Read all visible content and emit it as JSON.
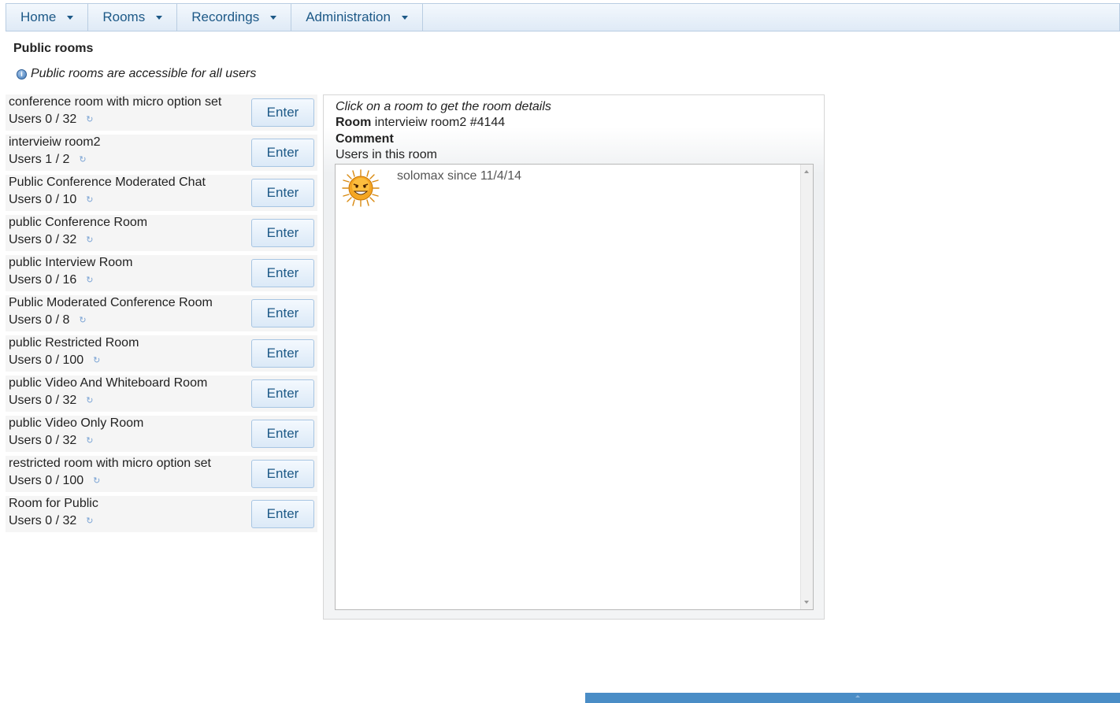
{
  "menu": {
    "items": [
      {
        "label": "Home"
      },
      {
        "label": "Rooms"
      },
      {
        "label": "Recordings"
      },
      {
        "label": "Administration"
      }
    ]
  },
  "page": {
    "title": "Public rooms",
    "info": "Public rooms are accessible for all users"
  },
  "rooms": [
    {
      "name": "conference room with micro option set",
      "users": "Users 0 / 32",
      "enter_label": "Enter"
    },
    {
      "name": "intervieiw room2",
      "users": "Users 1 / 2",
      "enter_label": "Enter"
    },
    {
      "name": "Public Conference Moderated Chat",
      "users": "Users 0 / 10",
      "enter_label": "Enter"
    },
    {
      "name": "public Conference Room",
      "users": "Users 0 / 32",
      "enter_label": "Enter"
    },
    {
      "name": "public Interview Room",
      "users": "Users 0 / 16",
      "enter_label": "Enter"
    },
    {
      "name": "Public Moderated Conference Room",
      "users": "Users 0 / 8",
      "enter_label": "Enter"
    },
    {
      "name": "public Restricted Room",
      "users": "Users 0 / 100",
      "enter_label": "Enter"
    },
    {
      "name": "public Video And Whiteboard Room",
      "users": "Users 0 / 32",
      "enter_label": "Enter"
    },
    {
      "name": "public Video Only Room",
      "users": "Users 0 / 32",
      "enter_label": "Enter"
    },
    {
      "name": "restricted room with micro option set",
      "users": "Users 0 / 100",
      "enter_label": "Enter"
    },
    {
      "name": "Room for Public",
      "users": "Users 0 / 32",
      "enter_label": "Enter"
    }
  ],
  "details": {
    "hint": "Click on a room to get the room details",
    "room_label": "Room",
    "room_value": "intervieiw room2 #4144",
    "comment_label": "Comment",
    "users_label": "Users in this room",
    "users": [
      {
        "text": "solomax since 11/4/14"
      }
    ]
  },
  "icons": {
    "menu_caret": "chevron-down-icon",
    "info": "info-icon",
    "refresh": "refresh-icon",
    "avatar": "sun-avatar-icon"
  },
  "colors": {
    "menu_text": "#1d5987",
    "menu_bg": "#dfeaf6",
    "button_bg": "#dbe9f7",
    "bottom_bar": "#4a8dc6"
  }
}
